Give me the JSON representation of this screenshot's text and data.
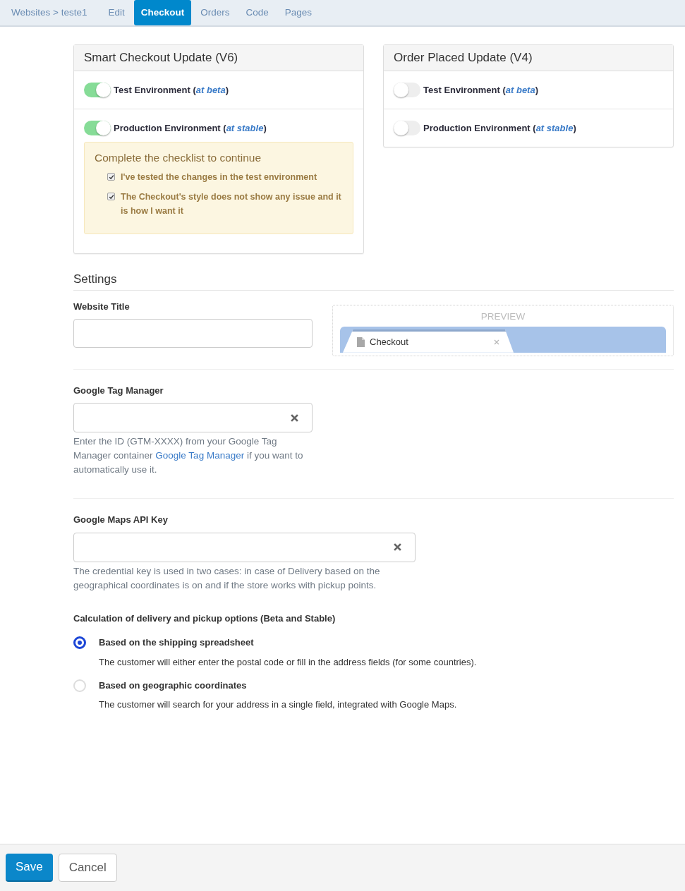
{
  "nav": {
    "items": [
      {
        "label": "Websites > teste1",
        "kind": "breadcrumb",
        "selected": false
      },
      {
        "label": "Edit",
        "kind": "tab",
        "selected": false
      },
      {
        "label": "Checkout",
        "kind": "tab",
        "selected": true
      },
      {
        "label": "Orders",
        "kind": "tab",
        "selected": false
      },
      {
        "label": "Code",
        "kind": "tab",
        "selected": false
      },
      {
        "label": "Pages",
        "kind": "tab",
        "selected": false
      }
    ]
  },
  "update_panels": [
    {
      "title": "Smart Checkout Update (V6)",
      "environments": [
        {
          "label": "Test Environment (*at beta*)",
          "on": true
        },
        {
          "label": "Production Environment (*at stable*)",
          "on": true
        }
      ],
      "checklist": {
        "title": "Complete the checklist to continue",
        "items": [
          {
            "label": "I've tested the changes in the test environment",
            "checked": true
          },
          {
            "label": "The Checkout's style does not show any issue and it is how I want it",
            "checked": true
          }
        ]
      }
    },
    {
      "title": "Order Placed Update (V4)",
      "environments": [
        {
          "label": "Test Environment (*at beta*)",
          "on": false
        },
        {
          "label": "Production Environment (*at stable*)",
          "on": false
        }
      ]
    }
  ],
  "settings": {
    "title": "Settings",
    "website_title": {
      "label": "Website Title",
      "preview": {
        "title": "PREVIEW",
        "tab_title": "Checkout"
      }
    },
    "google_tag_manager": {
      "label": "Google Tag Manager",
      "help": {
        "before": "Enter the ID (GTM-XXXX) from your Google Tag Manager container",
        "link": "Google Tag Manager",
        "after": "if you want to automatically use it."
      }
    },
    "google_maps_api_key": {
      "label": "Google Maps API Key",
      "help": "The credential key is used in two cases: in case of Delivery based on the geographical coordinates is on and if the store works with pickup points."
    },
    "delivery_calculation": {
      "label": "Calculation of delivery and pickup options (Beta and Stable)",
      "options": [
        {
          "label": "Based on the shipping spreadsheet",
          "description": "The customer will either enter the postal code or fill in the address fields (for some countries).",
          "selected": true
        },
        {
          "label": "Based on geographic coordinates",
          "description": "The customer will search for your address in a single field, integrated with Google Maps.",
          "selected": false
        }
      ]
    }
  },
  "footer": {
    "buttons": [
      {
        "label": "Save",
        "kind": "primary"
      },
      {
        "label": "Cancel",
        "kind": "default"
      }
    ]
  }
}
